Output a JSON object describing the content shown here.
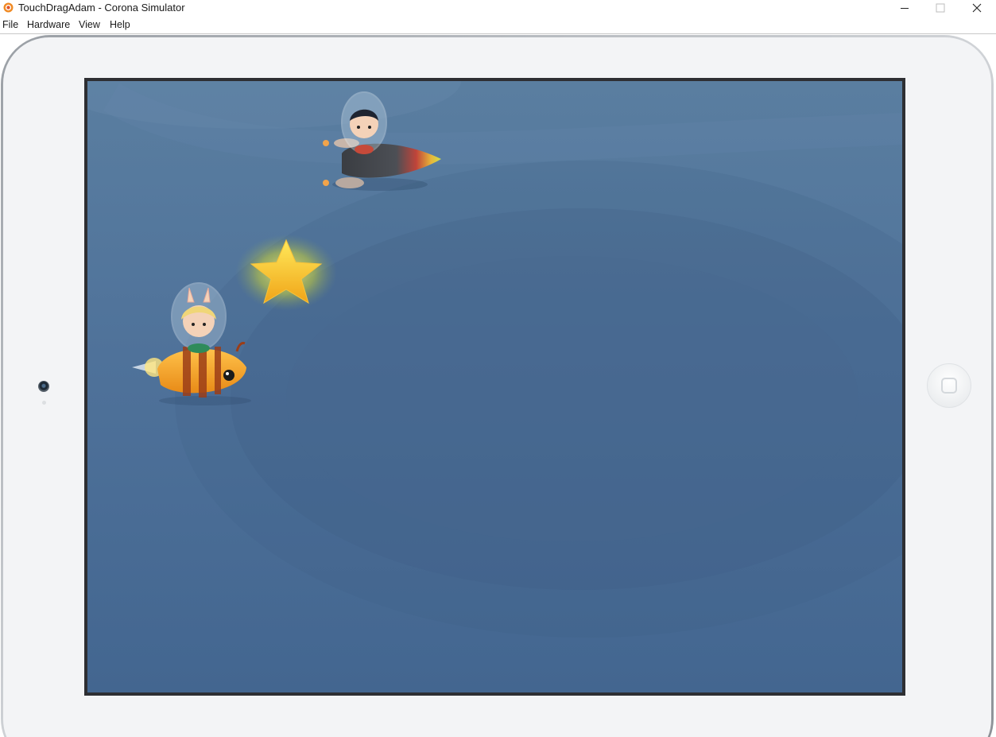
{
  "window": {
    "title": "TouchDragAdam - Corona Simulator",
    "app_icon": "corona-logo-icon",
    "controls": [
      "minimize-icon",
      "maximize-icon",
      "close-icon"
    ]
  },
  "menu": {
    "items": [
      {
        "label": "File"
      },
      {
        "label": "Hardware"
      },
      {
        "label": "View"
      },
      {
        "label": "Help"
      }
    ]
  },
  "device": {
    "skin": "iPad (landscape)",
    "bezel_color": "#f3f4f6",
    "screen_background": "#4f729a",
    "icons": [
      "front-camera-icon",
      "home-button-icon"
    ]
  },
  "game": {
    "sprites": [
      {
        "name": "rocket-boy-sprite"
      },
      {
        "name": "star-sprite"
      },
      {
        "name": "bee-rocket-girl-sprite"
      }
    ]
  }
}
